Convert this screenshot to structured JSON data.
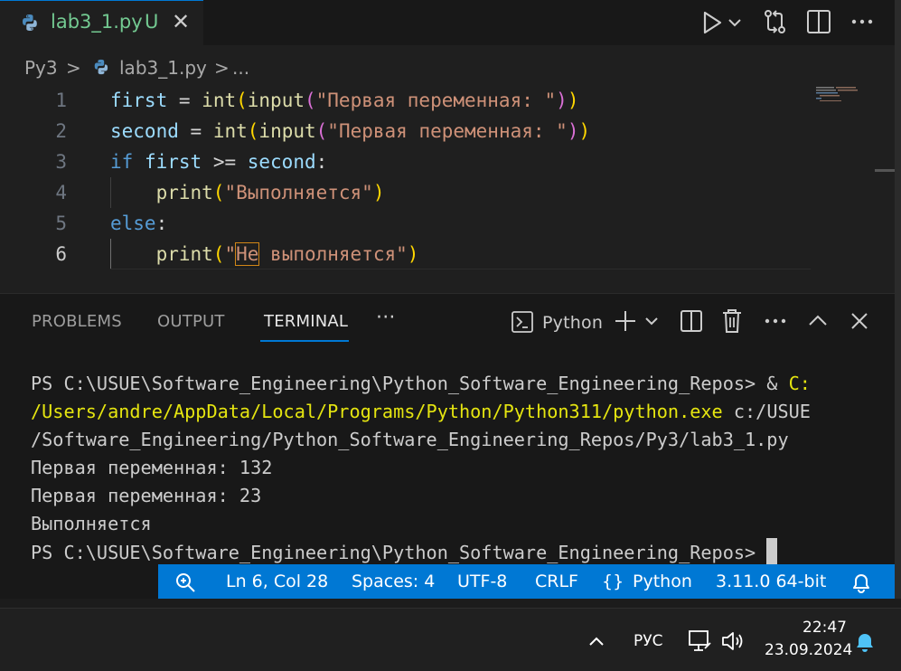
{
  "tab": {
    "filename": "lab3_1.py",
    "status": "U",
    "close_icon": "close-icon"
  },
  "toolbar": {
    "run_icon": "run-icon",
    "run_dropdown_icon": "chevron-down-icon",
    "compare_icon": "source-control-compare-icon",
    "split_icon": "split-editor-icon",
    "more_icon": "more-icon"
  },
  "breadcrumb": {
    "folder": "Py3",
    "sep1": ">",
    "file": "lab3_1.py",
    "sep2": ">",
    "ellipsis": "..."
  },
  "editor": {
    "line_numbers": [
      "1",
      "2",
      "3",
      "4",
      "5",
      "6"
    ],
    "active_line": "6"
  },
  "panel": {
    "tabs": [
      "PROBLEMS",
      "OUTPUT",
      "TERMINAL"
    ],
    "active_tab": "TERMINAL",
    "more": "···",
    "terminal_name": "Python",
    "terminal_lines": {
      "l1a": "PS C:\\USUE\\Software_Engineering\\Python_Software_Engineering_Repos> & ",
      "l1b": "C:",
      "l2a": "/Users/andre/AppData/Local/Programs/Python/Python311/python.exe",
      "l2b": " c:/USUE",
      "l3": "/Software_Engineering/Python_Software_Engineering_Repos/Py3/lab3_1.py",
      "l4": "Первая переменная: 132",
      "l5": "Первая переменная: 23",
      "l6": "Выполняется",
      "l7": "PS C:\\USUE\\Software_Engineering\\Python_Software_Engineering_Repos> "
    }
  },
  "statusbar": {
    "zoom_icon": "zoom-icon",
    "position": "Ln 6, Col 28",
    "spaces": "Spaces: 4",
    "encoding": "UTF-8",
    "eol": "CRLF",
    "braces": "{}",
    "language": "Python",
    "interpreter": "3.11.0 64-bit",
    "bell_icon": "bell-icon"
  },
  "taskbar": {
    "language": "РУС",
    "time": "22:47",
    "date": "23.09.2024"
  },
  "colors": {
    "accent": "#0078d4",
    "modified_green": "#73c991",
    "terminal_yellow": "#e5e510"
  }
}
